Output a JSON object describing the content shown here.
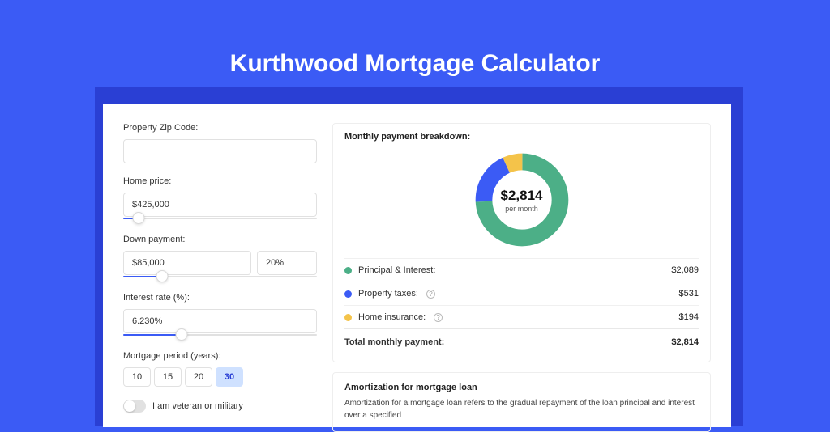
{
  "title": "Kurthwood Mortgage Calculator",
  "form": {
    "zip_label": "Property Zip Code:",
    "zip_value": "",
    "home_price_label": "Home price:",
    "home_price_value": "$425,000",
    "home_price_fill_pct": 8,
    "down_label": "Down payment:",
    "down_value": "$85,000",
    "down_pct_value": "20%",
    "down_fill_pct": 20,
    "rate_label": "Interest rate (%):",
    "rate_value": "6.230%",
    "rate_fill_pct": 30,
    "period_label": "Mortgage period (years):",
    "periods": [
      "10",
      "15",
      "20",
      "30"
    ],
    "period_selected": "30",
    "veteran_label": "I am veteran or military"
  },
  "breakdown": {
    "title": "Monthly payment breakdown:",
    "donut_total": "$2,814",
    "donut_sub": "per month",
    "items": [
      {
        "label": "Principal & Interest:",
        "value": "$2,089",
        "color": "green",
        "info": false
      },
      {
        "label": "Property taxes:",
        "value": "$531",
        "color": "blue",
        "info": true
      },
      {
        "label": "Home insurance:",
        "value": "$194",
        "color": "yellow",
        "info": true
      }
    ],
    "total_label": "Total monthly payment:",
    "total_value": "$2,814"
  },
  "amort": {
    "title": "Amortization for mortgage loan",
    "text": "Amortization for a mortgage loan refers to the gradual repayment of the loan principal and interest over a specified"
  },
  "chart_data": {
    "type": "pie",
    "title": "Monthly payment breakdown",
    "series": [
      {
        "name": "Principal & Interest",
        "value": 2089,
        "color": "#4caf87"
      },
      {
        "name": "Property taxes",
        "value": 531,
        "color": "#3b5bf5"
      },
      {
        "name": "Home insurance",
        "value": 194,
        "color": "#f4c34a"
      }
    ],
    "total": 2814,
    "unit": "USD per month"
  }
}
